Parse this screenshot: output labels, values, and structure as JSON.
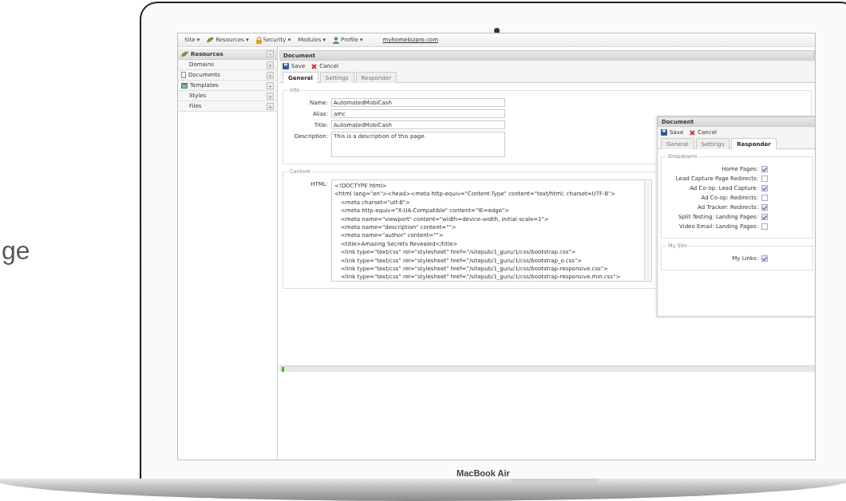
{
  "backdrop_text": "ge",
  "laptop": {
    "label": "MacBook Air"
  },
  "menu_bar": {
    "items": [
      {
        "label": "Site",
        "caret": "▾",
        "kind": "plain"
      },
      {
        "label": "Resources",
        "caret": "▾",
        "kind": "resources"
      },
      {
        "label": "Security",
        "caret": "▾",
        "kind": "security"
      },
      {
        "label": "Modules",
        "caret": "▾",
        "kind": "plain"
      },
      {
        "label": "Profile",
        "caret": "▾",
        "kind": "profile"
      }
    ],
    "link": "myhomebizpro.com"
  },
  "sidebar": {
    "title": "Resources",
    "collapse": "«",
    "items": [
      {
        "label": "Domains",
        "button": "+",
        "kind": "sub"
      },
      {
        "label": "Documents",
        "button": "+",
        "kind": "documents"
      },
      {
        "label": "Templates",
        "button": "+",
        "kind": "templates"
      },
      {
        "label": "Styles",
        "button": "+",
        "kind": "sub"
      },
      {
        "label": "Files",
        "button": "+",
        "kind": "sub"
      }
    ]
  },
  "document": {
    "title": "Document",
    "toolbar": [
      {
        "label": "Save",
        "kind": "save"
      },
      {
        "label": "Cancel",
        "kind": "cancel"
      }
    ],
    "tabs": [
      {
        "label": "General",
        "selected": true
      },
      {
        "label": "Settings",
        "selected": false
      },
      {
        "label": "Responder",
        "selected": false
      }
    ],
    "info": {
      "legend": "Info",
      "fields": [
        {
          "label": "Name:",
          "value": "AutomatedMobiCash",
          "kind": "text"
        },
        {
          "label": "Alias:",
          "value": "amc",
          "kind": "text"
        },
        {
          "label": "Title:",
          "value": "AutomatedMobiCash",
          "kind": "text"
        },
        {
          "label": "Description:",
          "value": "This is a description of this page.",
          "kind": "textarea"
        }
      ]
    },
    "content": {
      "legend": "Content",
      "label": "HTML:",
      "lines": [
        {
          "text": "<!DOCTYPE html>"
        },
        {
          "text": "<html lang=\"en\"><head><meta http-equiv=\"Content-Type\" content=\"text/html; charset=UTF-8\">",
          "children": [
            {
              "text": "<meta charset=\"utf-8\">"
            },
            {
              "text": "<meta http-equiv=\"X-UA-Compatible\" content=\"IE=edge\">"
            },
            {
              "text": "<meta name=\"viewport\" content=\"width=device-width, initial-scale=1\">"
            },
            {
              "text": "<meta name=\"description\" content=\"\">"
            },
            {
              "text": "<meta name=\"author\" content=\"\">"
            },
            {
              "text": "<title>Amazing Secrets Revealed</title>"
            },
            {
              "text": "<link type=\"text/css\" rel=\"stylesheet\" href=\"/sitepub/1_guru/1/css/bootstrap.css\">"
            },
            {
              "text": "<link type=\"text/css\" rel=\"stylesheet\" href=\"/sitepub/1_guru/1/css/bootstrap_o.css\">"
            },
            {
              "text": "<link type=\"text/css\" rel=\"stylesheet\" href=\"/sitepub/1_guru/1/css/bootstrap-responsive.css\">"
            },
            {
              "text": "<link type=\"text/css\" rel=\"stylesheet\" href=\"/sitepub/1_guru/1/css/bootstrap-responsive.min.css\">"
            }
          ]
        }
      ]
    }
  },
  "responder_panel": {
    "title": "Document",
    "toolbar": [
      {
        "label": "Save",
        "kind": "save"
      },
      {
        "label": "Cancel",
        "kind": "cancel"
      }
    ],
    "tabs": [
      {
        "label": "General",
        "selected": false
      },
      {
        "label": "Settings",
        "selected": false
      },
      {
        "label": "Responder",
        "selected": true
      }
    ],
    "groups": [
      {
        "legend": "Dropdowns",
        "options": [
          {
            "label": "Home Pages:",
            "checked": true
          },
          {
            "label": "Lead Capture Page Redirects:",
            "checked": false
          },
          {
            "label": "Ad Co-op: Lead Capture:",
            "checked": true
          },
          {
            "label": "Ad Co-op: Redirects:",
            "checked": false
          },
          {
            "label": "Ad Tracker: Redirects:",
            "checked": true
          },
          {
            "label": "Split Testing: Landing Pages:",
            "checked": true
          },
          {
            "label": "Video Email: Landing Pages:",
            "checked": false
          }
        ]
      },
      {
        "legend": "My Site",
        "options": [
          {
            "label": "My Links:",
            "checked": true
          }
        ]
      }
    ]
  }
}
